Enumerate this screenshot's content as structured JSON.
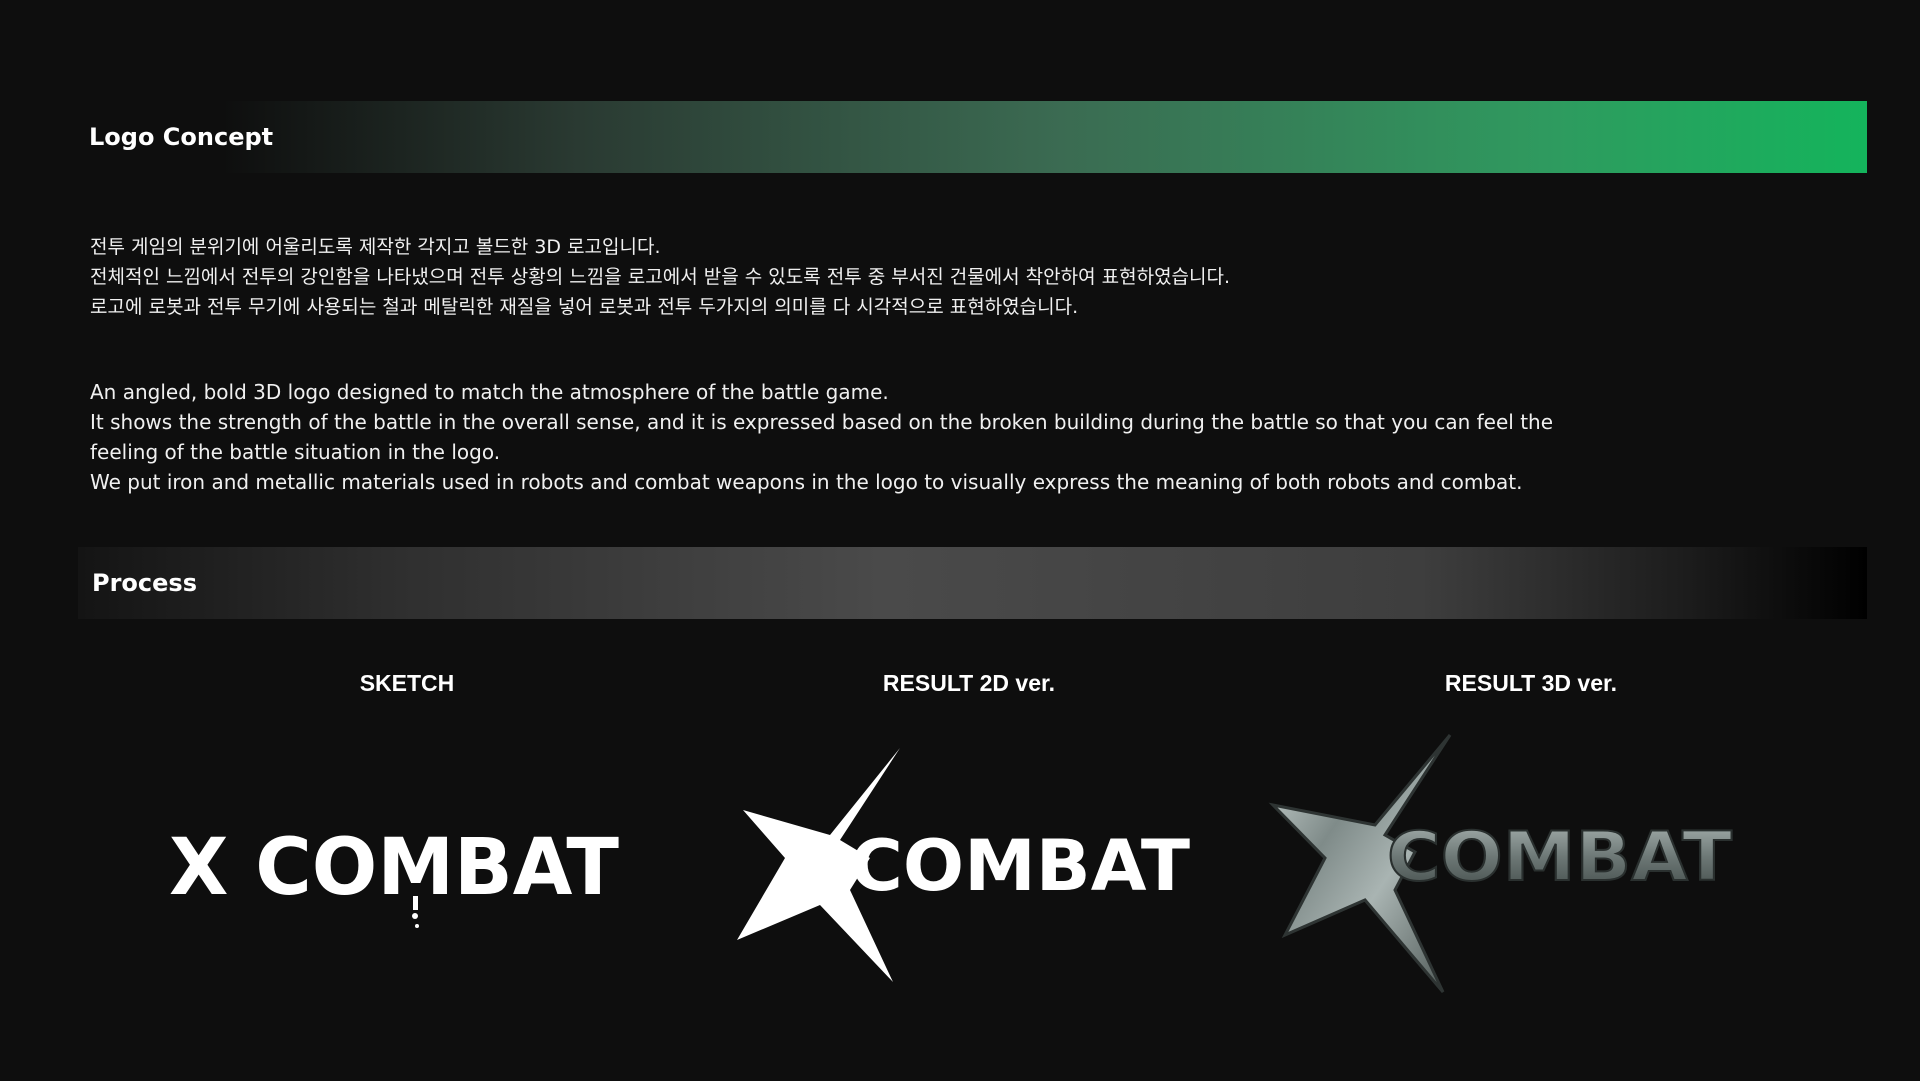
{
  "logo_concept": {
    "title": "Logo Concept",
    "korean_lines": [
      "전투 게임의 분위기에 어울리도록 제작한 각지고 볼드한 3D 로고입니다.",
      "전체적인 느낌에서 전투의 강인함을 나타냈으며 전투 상황의 느낌을 로고에서 받을 수 있도록 전투 중 부서진 건물에서 착안하여 표현하였습니다.",
      "로고에 로봇과 전투 무기에 사용되는 철과 메탈릭한 재질을 넣어 로봇과 전투 두가지의 의미를 다 시각적으로 표현하였습니다."
    ],
    "english_lines": [
      "An angled, bold 3D logo designed to match the atmosphere of the battle game.",
      "It shows the strength of the battle in the overall sense, and it is expressed based on the broken building during the battle so that you can feel the",
      "feeling of the battle situation in the logo.",
      "We put iron and metallic materials used in robots and combat weapons in the logo to visually express the meaning of both robots and combat."
    ]
  },
  "process": {
    "title": "Process",
    "columns": [
      {
        "label": "SKETCH",
        "logo_text": "X COMBAT"
      },
      {
        "label": "RESULT 2D ver.",
        "logo_x": "X",
        "logo_word": "COMBAT"
      },
      {
        "label": "RESULT 3D ver.",
        "logo_x": "X",
        "logo_word": "COMBAT"
      }
    ]
  },
  "colors": {
    "background": "#0e0e0e",
    "accent_green": "#14b45c",
    "text": "#f2f2f2",
    "metal_light": "#b8c2c0",
    "metal_dark": "#4e5856"
  }
}
